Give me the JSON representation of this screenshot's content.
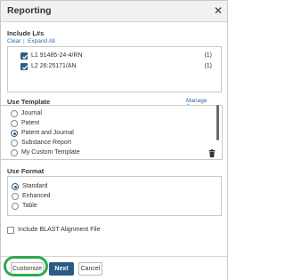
{
  "dialog": {
    "title": "Reporting",
    "close_glyph": "✕"
  },
  "include": {
    "label": "Include L#s",
    "clear_label": "Clear",
    "separator": "|",
    "expand_label": "Expand All",
    "items": [
      {
        "label": "L1  91485-24-4/RN",
        "count": "(1)",
        "checked": true
      },
      {
        "label": "L2  26:25171/AN",
        "count": "(1)",
        "checked": true
      }
    ]
  },
  "template": {
    "label": "Use Template",
    "manage_label": "Manage Custom",
    "options": [
      {
        "label": "Journal",
        "selected": false
      },
      {
        "label": "Patent",
        "selected": false
      },
      {
        "label": "Patent and Journal",
        "selected": true
      },
      {
        "label": "Substance Report",
        "selected": false
      },
      {
        "label": "My Custom Template",
        "selected": false
      }
    ]
  },
  "format": {
    "label": "Use Format",
    "options": [
      {
        "label": "Standard",
        "selected": true
      },
      {
        "label": "Enhanced",
        "selected": false
      },
      {
        "label": "Table",
        "selected": false
      }
    ]
  },
  "blast": {
    "label": "Include BLAST Alignment File",
    "checked": false
  },
  "footer": {
    "customize_label": "Customize",
    "next_label": "Next",
    "cancel_label": "Cancel"
  },
  "colors": {
    "accent": "#2a5b86",
    "link": "#2b6aa8",
    "highlight": "#2fa84f"
  },
  "icons": {
    "close": "close-icon",
    "trash": "trash-icon",
    "check": "check-icon"
  }
}
